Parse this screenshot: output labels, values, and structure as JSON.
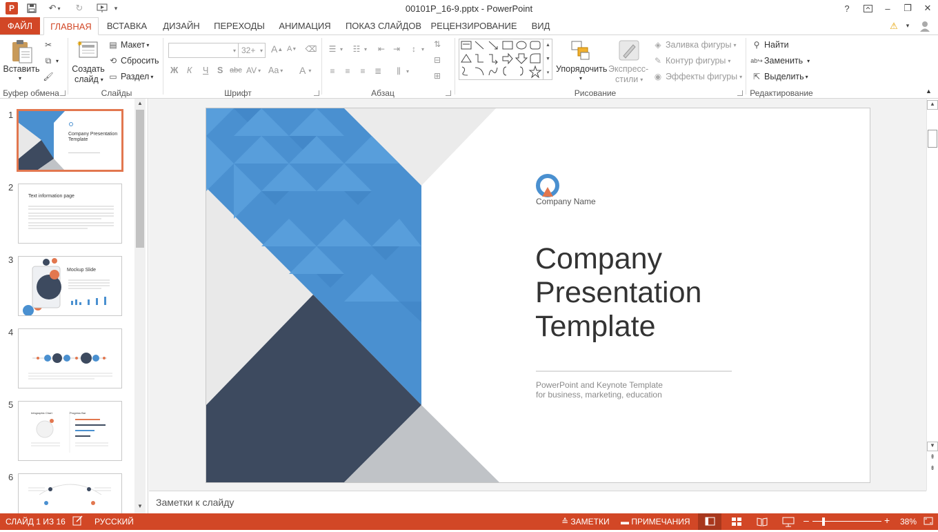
{
  "titlebar": {
    "doc_title": "00101P_16-9.pptx - PowerPoint",
    "app_icon": "P",
    "help": "?",
    "min": "–",
    "restore": "❐",
    "close": "✕"
  },
  "tabs": [
    "ФАЙЛ",
    "ГЛАВНАЯ",
    "ВСТАВКА",
    "ДИЗАЙН",
    "ПЕРЕХОДЫ",
    "АНИМАЦИЯ",
    "ПОКАЗ СЛАЙДОВ",
    "РЕЦЕНЗИРОВАНИЕ",
    "ВИД"
  ],
  "ribbon": {
    "clipboard": {
      "paste": "Вставить",
      "label": "Буфер обмена"
    },
    "slides": {
      "new_slide_1": "Создать",
      "new_slide_2": "слайд",
      "layout": "Макет",
      "reset": "Сбросить",
      "section": "Раздел",
      "label": "Слайды"
    },
    "font": {
      "size": "32+",
      "bold": "Ж",
      "italic": "К",
      "underline": "Ч",
      "shadow": "S",
      "strike": "abc",
      "spacing": "AV",
      "case": "Aa",
      "color": "A",
      "grow": "A",
      "shrink": "A",
      "label": "Шрифт"
    },
    "paragraph": {
      "label": "Абзац"
    },
    "drawing": {
      "arrange": "Упорядочить",
      "quick_styles_1": "Экспресс-",
      "quick_styles_2": "стили",
      "fill": "Заливка фигуры",
      "outline": "Контур фигуры",
      "effects": "Эффекты фигуры",
      "label": "Рисование"
    },
    "editing": {
      "find": "Найти",
      "replace": "Заменить",
      "select": "Выделить",
      "label": "Редактирование"
    }
  },
  "thumbnails": [
    {
      "num": "1",
      "title": "Company Presentation Template"
    },
    {
      "num": "2",
      "title": "Text information page"
    },
    {
      "num": "3",
      "title": "Mockup Slide"
    },
    {
      "num": "4",
      "title": ""
    },
    {
      "num": "5",
      "title_left": "Infographic Chart",
      "title_right": "Progress Bar"
    },
    {
      "num": "6",
      "title": ""
    }
  ],
  "slide": {
    "company_name": "Company Name",
    "title_line1": "Company",
    "title_line2": "Presentation",
    "title_line3": "Template",
    "subtitle_line1": "PowerPoint and Keynote Template",
    "subtitle_line2": "for business, marketing, education"
  },
  "notes_placeholder": "Заметки к слайду",
  "statusbar": {
    "slide_info": "СЛАЙД 1 ИЗ 16",
    "language": "РУССКИЙ",
    "notes": "ЗАМЕТКИ",
    "comments": "ПРИМЕЧАНИЯ",
    "zoom": "38%"
  },
  "colors": {
    "accent": "#d24726",
    "slide_blue": "#4a90d0",
    "slide_navy": "#3d4a5f",
    "slide_grey": "#c0c3c7"
  }
}
